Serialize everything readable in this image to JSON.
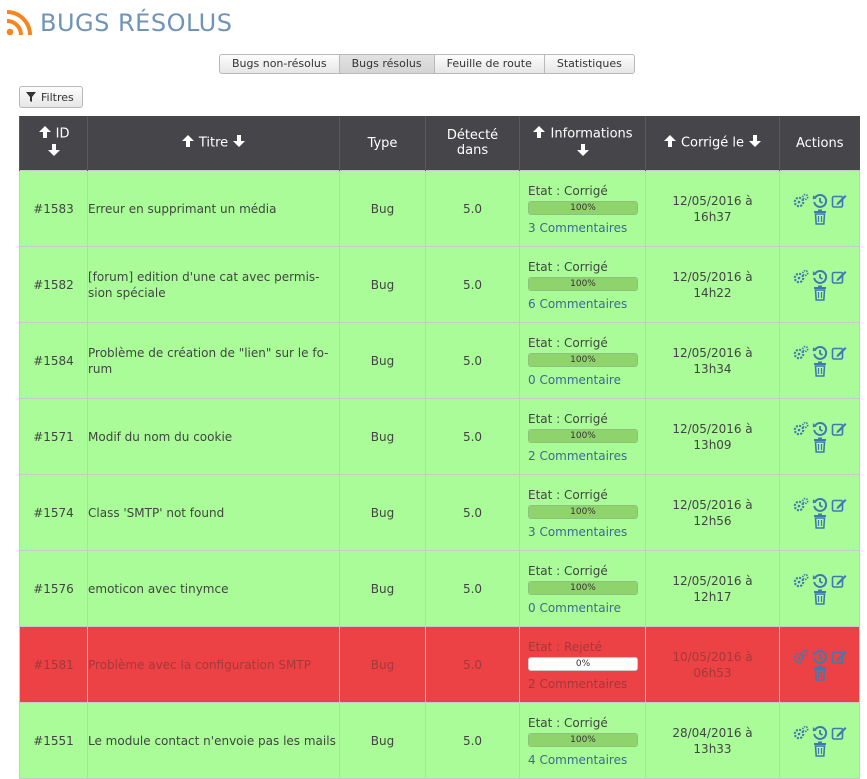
{
  "header": {
    "title": "BUGS RÉSOLUS",
    "icon": "rss-icon",
    "title_color": "#6f94b8",
    "icon_color": "#f5861f"
  },
  "tabs": [
    {
      "label": "Bugs non-résolus",
      "active": false
    },
    {
      "label": "Bugs résolus",
      "active": true
    },
    {
      "label": "Feuille de route",
      "active": false
    },
    {
      "label": "Statistiques",
      "active": false
    }
  ],
  "filter": {
    "label": "Filtres",
    "icon": "filter-icon"
  },
  "table": {
    "columns": {
      "id": "ID",
      "title": "Titre",
      "type": "Type",
      "detected": "Détecté dans",
      "info": "Informations",
      "fixed": "Corrigé le",
      "actions": "Actions"
    },
    "rows": [
      {
        "id": "#1583",
        "title": "Erreur en supprimant un média",
        "type": "Bug",
        "detected": "5.0",
        "status": "Etat : Corrigé",
        "progress": "100%",
        "comments": "3 Commentaires",
        "date": "12/05/2016 à",
        "time": "16h37",
        "state": "fixed"
      },
      {
        "id": "#1582",
        "title": "[forum] edition d'une cat avec permis-sion spéciale",
        "type": "Bug",
        "detected": "5.0",
        "status": "Etat : Corrigé",
        "progress": "100%",
        "comments": "6 Commentaires",
        "date": "12/05/2016 à",
        "time": "14h22",
        "state": "fixed"
      },
      {
        "id": "#1584",
        "title": "Problème de création de \"lien\" sur le fo-rum",
        "type": "Bug",
        "detected": "5.0",
        "status": "Etat : Corrigé",
        "progress": "100%",
        "comments": "0 Commentaire",
        "date": "12/05/2016 à",
        "time": "13h34",
        "state": "fixed"
      },
      {
        "id": "#1571",
        "title": "Modif du nom du cookie",
        "type": "Bug",
        "detected": "5.0",
        "status": "Etat : Corrigé",
        "progress": "100%",
        "comments": "2 Commentaires",
        "date": "12/05/2016 à",
        "time": "13h09",
        "state": "fixed"
      },
      {
        "id": "#1574",
        "title": "Class 'SMTP' not found",
        "type": "Bug",
        "detected": "5.0",
        "status": "Etat : Corrigé",
        "progress": "100%",
        "comments": "3 Commentaires",
        "date": "12/05/2016 à",
        "time": "12h56",
        "state": "fixed"
      },
      {
        "id": "#1576",
        "title": "emoticon avec tinymce",
        "type": "Bug",
        "detected": "5.0",
        "status": "Etat : Corrigé",
        "progress": "100%",
        "comments": "0 Commentaire",
        "date": "12/05/2016 à",
        "time": "12h17",
        "state": "fixed"
      },
      {
        "id": "#1581",
        "title": "Problème avec la configuration SMTP",
        "type": "Bug",
        "detected": "5.0",
        "status": "Etat : Rejeté",
        "progress": "0%",
        "comments": "2 Commentaires",
        "date": "10/05/2016 à",
        "time": "06h53",
        "state": "rejected"
      },
      {
        "id": "#1551",
        "title": "Le module contact n'envoie pas les mails",
        "type": "Bug",
        "detected": "5.0",
        "status": "Etat : Corrigé",
        "progress": "100%",
        "comments": "4 Commentaires",
        "date": "28/04/2016 à",
        "time": "13h33",
        "state": "fixed"
      }
    ]
  },
  "colors": {
    "fixed_row": "#a9fc98",
    "rejected_row": "#ec4145",
    "header_bg": "#46464a",
    "link": "#3a6a9a",
    "progress": "#8fd36c"
  },
  "action_icons": [
    "cogs-icon",
    "history-icon",
    "edit-icon",
    "trash-icon"
  ]
}
